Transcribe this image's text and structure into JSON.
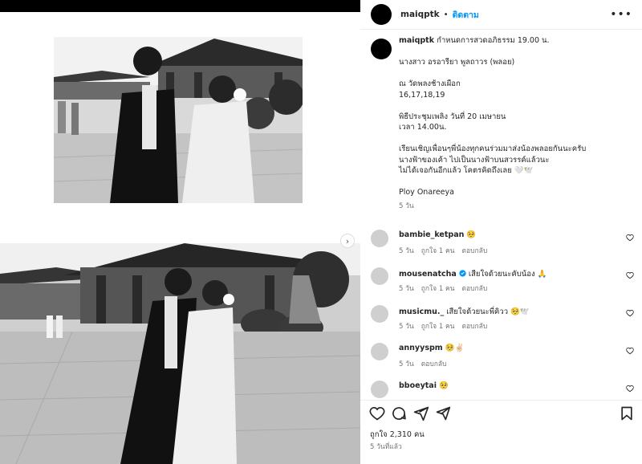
{
  "post": {
    "username": "maiqptk",
    "follow_label": "ติดตาม",
    "more_icon": "more-options-icon"
  },
  "caption": {
    "username": "maiqptk",
    "lines": [
      "กำหนดการสวดอภิธรรม 19.00 น.",
      "",
      "นางสาว อรอารียา พูลถาวร (พลอย)",
      "",
      "ณ วัดพลงช้างเผือก",
      "16,17,18,19",
      "",
      "พิธีประชุมเพลิง วันที่ 20 เมษายน",
      "เวลา 14.00น.",
      "",
      "เรียนเชิญเพื่อนๆพี่น้องทุกคนร่วมมาส่งน้องพลอยกันนะครับ",
      "นางฟ้าของเค้า ไปเป็นนางฟ้าบนสวรรค์แล้วนะ",
      "ไม่ได้เจอกันอีกแล้ว โคตรคิดถึงเลย 🤍🕊️",
      "",
      "Ploy Onareeya"
    ],
    "time": "5 วัน"
  },
  "comments": [
    {
      "username": "bambie_ketpan",
      "text": "🥺",
      "time": "5 วัน",
      "likes": "ถูกใจ 1 คน",
      "reply": "ตอบกลับ",
      "verified": false
    },
    {
      "username": "mousenatcha",
      "text": "เสียใจด้วยนะคับน้อง 🙏",
      "time": "5 วัน",
      "likes": "ถูกใจ 1 คน",
      "reply": "ตอบกลับ",
      "verified": true
    },
    {
      "username": "musicmu._",
      "text": "เสียใจด้วยนะพี่คิวว 🥺🕊️",
      "time": "5 วัน",
      "likes": "ถูกใจ 1 คน",
      "reply": "ตอบกลับ",
      "verified": false
    },
    {
      "username": "annyyspm",
      "text": "🥺✌🏻",
      "time": "5 วัน",
      "likes": "",
      "reply": "ตอบกลับ",
      "verified": false
    },
    {
      "username": "bboeytai",
      "text": "🥺",
      "time": "",
      "likes": "",
      "reply": "",
      "verified": false
    }
  ],
  "actions": {
    "icons": [
      "heart-icon",
      "comment-icon",
      "share-icon",
      "bookmark-icon"
    ],
    "likes_text": "ถูกใจ 2,310 คน",
    "posted_text": "5 วันที่แล้ว"
  },
  "colors": {
    "link": "#0095f6",
    "secondary_text": "#737373",
    "primary_text": "#262626",
    "verified": "#0095f6"
  }
}
